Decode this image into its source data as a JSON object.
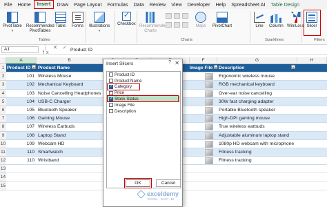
{
  "menu_tabs": [
    "File",
    "Home",
    "Insert",
    "Draw",
    "Page Layout",
    "Formulas",
    "Data",
    "Review",
    "View",
    "Developer",
    "Help",
    "Spreadsheet AI",
    "Table Design"
  ],
  "ribbon": {
    "pivot_table": "PivotTable",
    "recommended_pivot": "Recommended PivotTables",
    "table": "Table",
    "forms": "Forms",
    "illustrations": "Illustrations",
    "checkbox": "Checkbox",
    "recommended_charts": "Recommended Charts",
    "maps": "Maps",
    "pivot_chart": "PivotChart",
    "line": "Line",
    "column": "Column",
    "win_loss": "Win/Loss",
    "slicer": "Slicer",
    "group_tables": "Tables",
    "group_charts": "Charts",
    "group_sparklines": "Sparklines",
    "group_filters": "Filters"
  },
  "formula_bar": {
    "cell_ref": "A1",
    "fx_icons": "⋮ ✕ ✓ fx",
    "content": "Product ID"
  },
  "columns": [
    "A",
    "B",
    "C",
    "D",
    "E",
    "F",
    "G",
    "H"
  ],
  "rows": [
    "1",
    "2",
    "3",
    "4",
    "5",
    "6",
    "7",
    "8",
    "9",
    "10",
    "11",
    "12",
    "13",
    "14",
    "15"
  ],
  "table": {
    "headers": [
      "Product ID",
      "Product Name",
      "Image File",
      "Description"
    ],
    "rows": [
      {
        "id": "101",
        "name": "Wireless Mouse",
        "desc": "Ergonomic wireless mouse"
      },
      {
        "id": "102",
        "name": "Mechanical Keyboard",
        "desc": "RGB mechanical keyboard"
      },
      {
        "id": "103",
        "name": "Noise Cancelling Headphones",
        "desc": "Over-ear noise cancelling"
      },
      {
        "id": "104",
        "name": "USB-C Charger",
        "desc": "30W fast charging adapter"
      },
      {
        "id": "105",
        "name": "Bluetooth Speaker",
        "desc": "Portable Bluetooth speaker"
      },
      {
        "id": "106",
        "name": "Gaming Mouse",
        "desc": "High-DPI gaming mouse"
      },
      {
        "id": "107",
        "name": "Wireless Earbuds",
        "desc": "True wireless earbuds"
      },
      {
        "id": "108",
        "name": "Laptop Stand",
        "desc": "Adjustable aluminum laptop stand"
      },
      {
        "id": "109",
        "name": "Webcam HD",
        "desc": "1080p HD webcam with microphone"
      },
      {
        "id": "110",
        "name": "Smartwatch",
        "desc": "Fitness tracking"
      },
      {
        "id": "110",
        "name": "Wristband",
        "desc": "Fitness tracking"
      }
    ]
  },
  "dialog": {
    "title": "Insert Slicers",
    "help": "?",
    "close": "✕",
    "options": [
      {
        "label": "Product ID",
        "checked": false
      },
      {
        "label": "Product Name",
        "checked": false
      },
      {
        "label": "Category",
        "checked": true
      },
      {
        "label": "Price",
        "checked": false
      },
      {
        "label": "Stock Status",
        "checked": true
      },
      {
        "label": "Image File",
        "checked": false
      },
      {
        "label": "Description",
        "checked": false
      }
    ],
    "ok": "OK",
    "cancel": "Cancel"
  },
  "watermark": {
    "name": "exceldemy",
    "tagline": "EXCEL · DATA · BI"
  },
  "colors": {
    "header_bg": "#1f5f99",
    "band": "#dbe9f7",
    "highlight": "#c00000",
    "excel_green": "#1e7145"
  }
}
